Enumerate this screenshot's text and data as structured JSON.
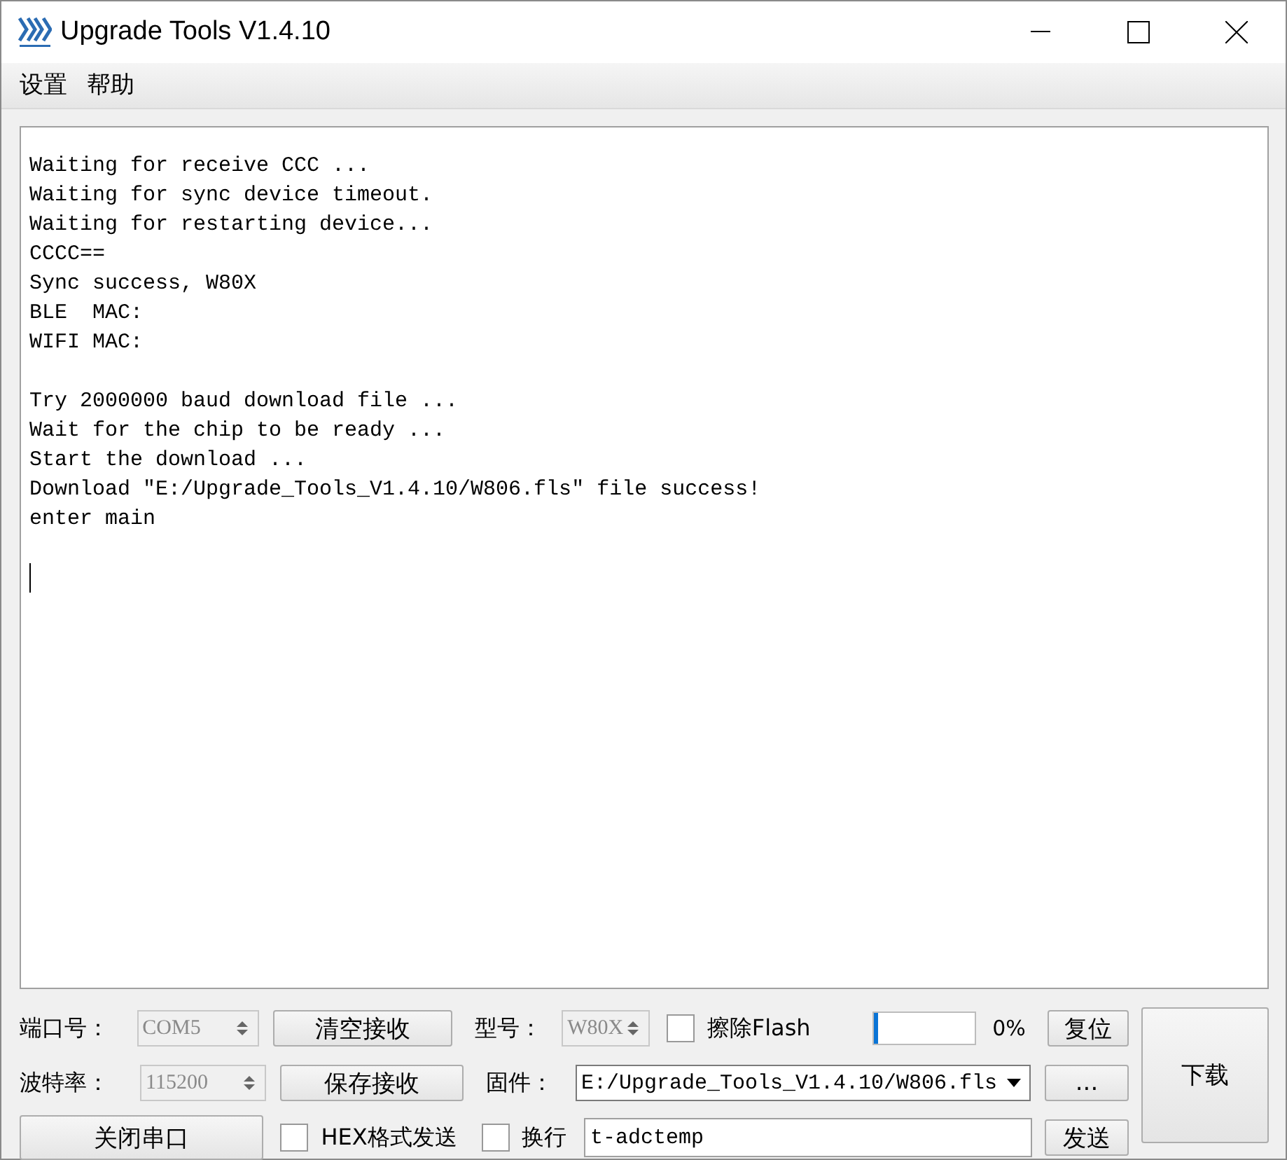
{
  "window": {
    "title": "Upgrade Tools V1.4.10"
  },
  "menu": [
    {
      "label": "设置"
    },
    {
      "label": "帮助"
    }
  ],
  "log": {
    "paragraphs": [
      [
        "Waiting for receive CCC ...",
        "Waiting for sync device timeout.",
        "Waiting for restarting device...",
        "CCCC==",
        "Sync success, W80X",
        "BLE  MAC:",
        "WIFI MAC:"
      ],
      [
        "Try 2000000 baud download file ...",
        "Wait for the chip to be ready ...",
        "Start the download ...",
        "Download ″E:/Upgrade_Tools_V1.4.10/W806.fls″ file success!",
        "enter main"
      ]
    ]
  },
  "controls": {
    "port": {
      "label": "端口号：",
      "value": "COM5",
      "disabled": true
    },
    "clear_button": "清空接收",
    "model": {
      "label": "型号：",
      "value": "W80X",
      "disabled": true
    },
    "erase_flash": {
      "label": "擦除Flash",
      "checked": false
    },
    "progress": {
      "level": 0.05,
      "reading": "0%"
    },
    "reset_button": "复位",
    "baud": {
      "label": "波特率：",
      "value": "115200",
      "disabled": true
    },
    "save_button": "保存接收",
    "firmware": {
      "label": "固件：",
      "value": "E:/Upgrade_Tools_V1.4.10/W806.fls"
    },
    "browse_button": "...",
    "close_port_button": "关闭串口",
    "hex_send": {
      "label": "HEX格式发送",
      "checked": false
    },
    "newline": {
      "label": "换行",
      "checked": false
    },
    "send_input": {
      "value": "t-adctemp"
    },
    "send_button": "发送",
    "download_button": "下载"
  }
}
